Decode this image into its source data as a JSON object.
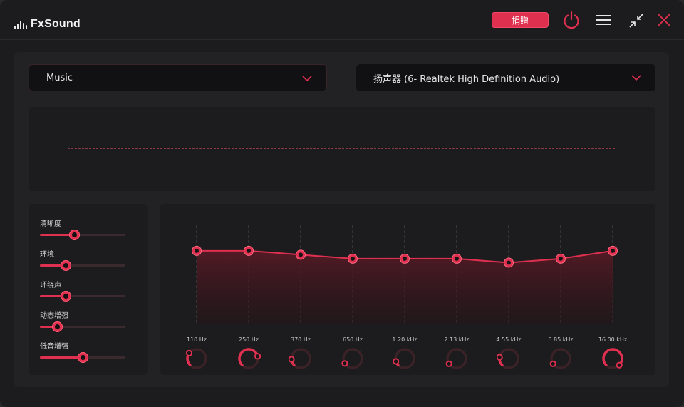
{
  "app": {
    "name": "FxSound",
    "donate_label": "捐贈"
  },
  "colors": {
    "accent": "#e03050",
    "background": "#1c1c1e",
    "panel": "#222224"
  },
  "icons": {
    "power": "power-icon",
    "menu": "hamburger-menu-icon",
    "collapse": "collapse-arrows-icon",
    "close": "close-x-icon",
    "chevron": "chevron-down-icon"
  },
  "preset": {
    "selected": "Music"
  },
  "output_device": {
    "selected": "扬声器 (6- Realtek High Definition Audio)"
  },
  "effects": [
    {
      "label": "清晰度",
      "value": 0.4
    },
    {
      "label": "环境",
      "value": 0.3
    },
    {
      "label": "环绕声",
      "value": 0.3
    },
    {
      "label": "动态增强",
      "value": 0.2
    },
    {
      "label": "低音增强",
      "value": 0.5
    }
  ],
  "equalizer": {
    "bands": [
      {
        "freq": "110 Hz",
        "level": 0.74,
        "knob": 0.3
      },
      {
        "freq": "250 Hz",
        "level": 0.74,
        "knob": 0.78
      },
      {
        "freq": "370 Hz",
        "level": 0.7,
        "knob": 0.15
      },
      {
        "freq": "650 Hz",
        "level": 0.66,
        "knob": 0.05
      },
      {
        "freq": "1.20 kHz",
        "level": 0.66,
        "knob": 0.1
      },
      {
        "freq": "2.13 kHz",
        "level": 0.66,
        "knob": 0.0
      },
      {
        "freq": "4.55 kHz",
        "level": 0.62,
        "knob": 0.2
      },
      {
        "freq": "6.85 kHz",
        "level": 0.66,
        "knob": 0.0
      },
      {
        "freq": "16.00 kHz",
        "level": 0.74,
        "knob": 1.0
      }
    ]
  }
}
